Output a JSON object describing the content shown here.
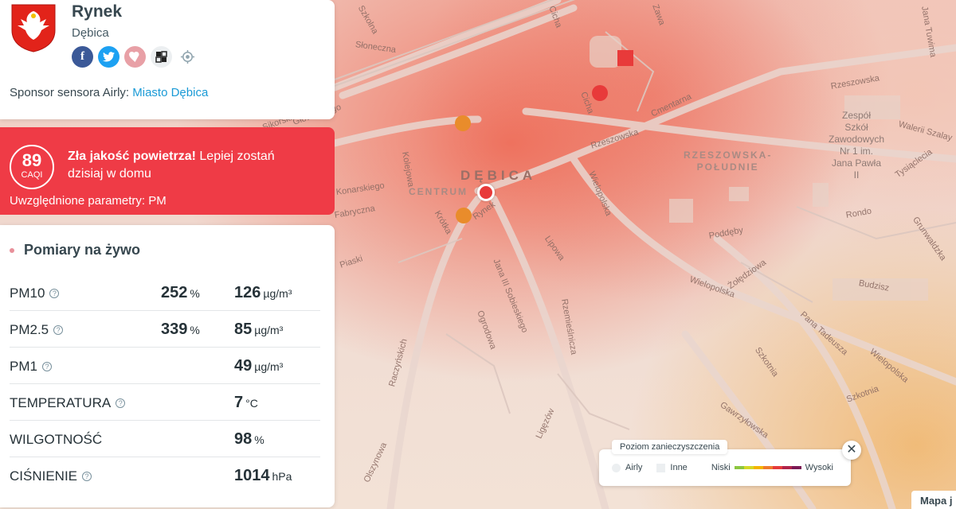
{
  "location": {
    "title": "Rynek",
    "city": "Dębica",
    "sponsor_prefix": "Sponsor sensora Airly:",
    "sponsor_name": "Miasto Dębica"
  },
  "social_icons": [
    "facebook-icon",
    "twitter-icon",
    "favorite-icon",
    "qr-code-icon",
    "locate-icon"
  ],
  "alert": {
    "caqi_value": "89",
    "caqi_unit": "CAQI",
    "message_bold": "Zła jakość powietrza!",
    "message": "Lepiej zostań dzisiaj w domu",
    "params": "Uwzględnione parametry: PM",
    "color": "#ef3b46"
  },
  "measurements": {
    "title": "Pomiary na żywo",
    "rows": [
      {
        "label": "PM10",
        "help": true,
        "percent": "252",
        "percent_unit": "%",
        "value": "126",
        "unit": "µg/m³"
      },
      {
        "label": "PM2.5",
        "help": true,
        "percent": "339",
        "percent_unit": "%",
        "value": "85",
        "unit": "µg/m³"
      },
      {
        "label": "PM1",
        "help": true,
        "percent": "",
        "percent_unit": "",
        "value": "49",
        "unit": "µg/m³"
      },
      {
        "label": "TEMPERATURA",
        "help": true,
        "percent": "",
        "percent_unit": "",
        "value": "7",
        "unit": "°C"
      },
      {
        "label": "WILGOTNOŚĆ",
        "help": false,
        "percent": "",
        "percent_unit": "",
        "value": "98",
        "unit": "%"
      },
      {
        "label": "CIŚNIENIE",
        "help": true,
        "percent": "",
        "percent_unit": "",
        "value": "1014",
        "unit": "hPa"
      }
    ]
  },
  "legend": {
    "title": "Poziom zanieczyszczenia",
    "airly": "Airly",
    "other": "Inne",
    "low": "Niski",
    "high": "Wysoki",
    "scale_colors": [
      "#8cc63f",
      "#d4d826",
      "#f4b400",
      "#ef7a2c",
      "#e53b3b",
      "#b0244a",
      "#7b1a55"
    ],
    "close": "✕"
  },
  "map": {
    "map_link": "Mapa j",
    "city_label": "DĘBICA",
    "district_centrum": "CENTRUM",
    "district_south": "RZESZOWSKA-\nPOŁUDNIE",
    "school_label": "Zespół\nSzkół\nZawodowych\nNr 1 im.\nJana Pawła\nII",
    "streets": [
      {
        "name": "Rzeszowska"
      },
      {
        "name": "Rzeszowska"
      },
      {
        "name": "Cmentarna"
      },
      {
        "name": "Wielopolska"
      },
      {
        "name": "Wielopolska"
      },
      {
        "name": "Wielopolska"
      },
      {
        "name": "Sikorskiego"
      },
      {
        "name": "Głowackiego"
      },
      {
        "name": "Konarskiego"
      },
      {
        "name": "Piaski"
      },
      {
        "name": "Kolejowa"
      },
      {
        "name": "Krótka"
      },
      {
        "name": "Rynek"
      },
      {
        "name": "Lipowa"
      },
      {
        "name": "Jana III Sobieskiego"
      },
      {
        "name": "Ogrodowa"
      },
      {
        "name": "Rzemieślnicza"
      },
      {
        "name": "Raczyńskich"
      },
      {
        "name": "Ligęzów"
      },
      {
        "name": "Poddęby"
      },
      {
        "name": "Żołędziowa"
      },
      {
        "name": "Pana Tadeusza"
      },
      {
        "name": "Szkotnia"
      },
      {
        "name": "Szkotnia"
      },
      {
        "name": "Gawrzyłowska"
      },
      {
        "name": "Rondo"
      },
      {
        "name": "Grunwaldzka"
      },
      {
        "name": "Budzisz"
      },
      {
        "name": "Tysiąclecia"
      },
      {
        "name": "Walerii Szalay"
      },
      {
        "name": "Słoneczna"
      },
      {
        "name": "Szkolna"
      },
      {
        "name": "Cicha"
      },
      {
        "name": "Cicha"
      },
      {
        "name": "Olszynowa"
      },
      {
        "name": "Fabryczna"
      },
      {
        "name": "Jana Tuwima"
      },
      {
        "name": "Zawa"
      }
    ],
    "sensor_colors": {
      "red": "#e83a3a",
      "orange": "#e98c2b"
    }
  }
}
